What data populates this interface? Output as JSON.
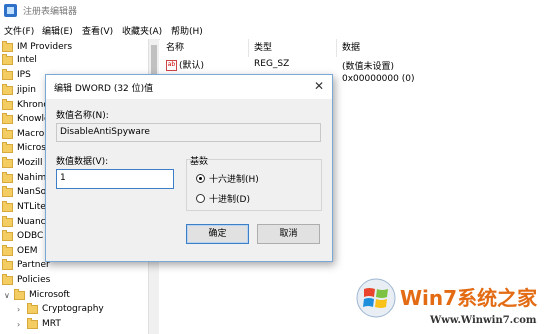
{
  "window": {
    "title": "注册表编辑器"
  },
  "menu": [
    "文件(F)",
    "编辑(E)",
    "查看(V)",
    "收藏夹(A)",
    "帮助(H)"
  ],
  "tree": {
    "items": [
      {
        "label": "IM Providers"
      },
      {
        "label": "Intel"
      },
      {
        "label": "IPS"
      },
      {
        "label": "jipin"
      },
      {
        "label": "Khrono"
      },
      {
        "label": "Knowle"
      },
      {
        "label": "Macro"
      },
      {
        "label": "Micros"
      },
      {
        "label": "Mozill"
      },
      {
        "label": "Nahim"
      },
      {
        "label": "NanSo"
      },
      {
        "label": "NTLite"
      },
      {
        "label": "Nuanc"
      },
      {
        "label": "ODBC"
      },
      {
        "label": "OEM"
      },
      {
        "label": "Partner"
      },
      {
        "label": "Policies"
      },
      {
        "label": "Microsoft"
      },
      {
        "label": "Cryptography"
      },
      {
        "label": "MRT"
      }
    ],
    "expanded_marker": "∨",
    "collapsed_marker": "›"
  },
  "list": {
    "headers": [
      "名称",
      "类型",
      "数据"
    ],
    "rows": [
      {
        "name": "(默认)",
        "type": "REG_SZ",
        "data": "(数值未设置)"
      },
      {
        "name": "",
        "type": "",
        "data": "0x00000000 (0)"
      }
    ],
    "ab_icon": "ab"
  },
  "dialog": {
    "title": "编辑 DWORD (32 位)值",
    "close": "✕",
    "value_name_label": "数值名称(N):",
    "value_name": "DisableAntiSpyware",
    "value_data_label": "数值数据(V):",
    "value_data": "1",
    "base_label": "基数",
    "radio_hex": "十六进制(H)",
    "radio_dec": "十进制(D)",
    "base_selected": "hex",
    "ok": "确定",
    "cancel": "取消"
  },
  "watermark": {
    "brand": "Win7系统之家",
    "url": "Www.Winwin7.com"
  }
}
